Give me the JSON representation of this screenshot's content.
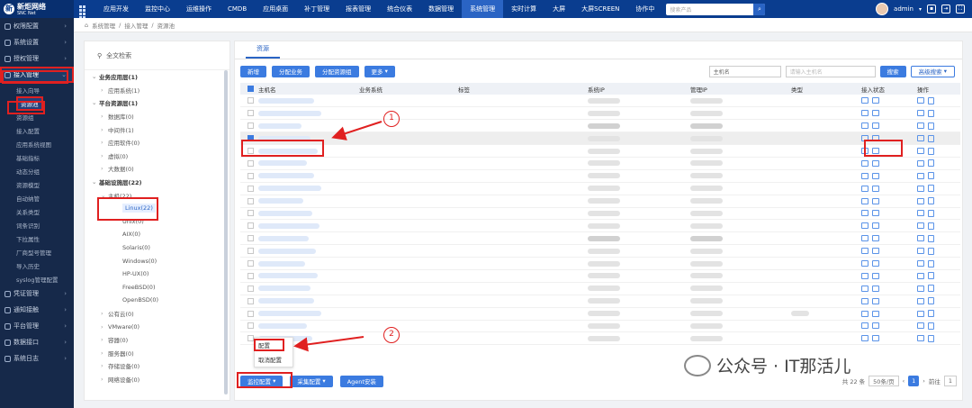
{
  "app": {
    "logo_title": "新炬网络",
    "logo_sub": "SNC Net"
  },
  "topnav": {
    "items": [
      "应用开发",
      "监控中心",
      "运维操作",
      "CMDB",
      "应用桌面",
      "补丁管理",
      "报表管理",
      "统合仪表",
      "数据管理",
      "系统管理",
      "实时计算",
      "大屏",
      "大屏SCREEN",
      "协作中"
    ],
    "active_index": 9,
    "search_placeholder": "搜索产品",
    "user": "admin"
  },
  "sidebar": {
    "items": [
      {
        "label": "权限配置"
      },
      {
        "label": "系统设置"
      },
      {
        "label": "授权管理"
      },
      {
        "label": "接入管理",
        "open": true
      }
    ],
    "sub_items": [
      "接入向导",
      "资源池",
      "资源组",
      "接入配置",
      "应用系统视图",
      "基础指标",
      "动态分组",
      "资源模型",
      "自动纳管",
      "关系类型",
      "词条识别",
      "下拉属性",
      "厂商型号管理",
      "导入历史",
      "syslog管理配置"
    ],
    "active_sub": 1,
    "bottom_items": [
      {
        "label": "凭证管理"
      },
      {
        "label": "通知接触"
      },
      {
        "label": "平台管理"
      },
      {
        "label": "数据接口"
      },
      {
        "label": "系统日志"
      }
    ]
  },
  "breadcrumb": [
    "系统管理",
    "接入管理",
    "资源池"
  ],
  "left_panel": {
    "search_label": "全文检索",
    "tree": [
      {
        "label": "业务应用层(1)",
        "level": 0
      },
      {
        "label": "应用系统(1)",
        "level": 1
      },
      {
        "label": "平台资源层(1)",
        "level": 0
      },
      {
        "label": "数据库(0)",
        "level": 1
      },
      {
        "label": "中间件(1)",
        "level": 1
      },
      {
        "label": "应用软件(0)",
        "level": 1
      },
      {
        "label": "虚拟(0)",
        "level": 1
      },
      {
        "label": "大数据(0)",
        "level": 1
      },
      {
        "label": "基础设施层(22)",
        "level": 0
      },
      {
        "label": "主机(22)",
        "level": 1,
        "expanded": true
      },
      {
        "label": "Linux(22)",
        "level": 2,
        "selected": true
      },
      {
        "label": "Unix(0)",
        "level": 2
      },
      {
        "label": "AIX(0)",
        "level": 2
      },
      {
        "label": "Solaris(0)",
        "level": 2
      },
      {
        "label": "Windows(0)",
        "level": 2
      },
      {
        "label": "HP-UX(0)",
        "level": 2
      },
      {
        "label": "FreeBSD(0)",
        "level": 2
      },
      {
        "label": "OpenBSD(0)",
        "level": 2
      },
      {
        "label": "公有云(0)",
        "level": 1
      },
      {
        "label": "VMware(0)",
        "level": 1
      },
      {
        "label": "容器(0)",
        "level": 1
      },
      {
        "label": "服务器(0)",
        "level": 1
      },
      {
        "label": "存储设备(0)",
        "level": 1
      },
      {
        "label": "网络设备(0)",
        "level": 1
      }
    ]
  },
  "main": {
    "tab": "资源",
    "toolbar": {
      "new": "新增",
      "assign_biz": "分配业务",
      "assign_group": "分配资源组",
      "more": "更多",
      "host_select": "主机名",
      "host_placeholder": "请输入主机名",
      "search": "搜索",
      "advanced": "高级搜索"
    },
    "columns": [
      "主机名",
      "业务系统",
      "标签",
      "系统IP",
      "管理IP",
      "类型",
      "接入状态",
      "操作"
    ],
    "row_count": 20,
    "selected_row": 3,
    "bottom": {
      "monitor_config": "监控配置",
      "collect_config": "采集配置",
      "agent_install": "Agent安装"
    },
    "popup_menu": [
      "配置",
      "取消配置"
    ],
    "pager": {
      "total": "共 22 条",
      "page_size": "50条/页",
      "current": "1",
      "goto": "前往",
      "goto_page": "1"
    }
  },
  "annotations": {
    "callout_1": "1",
    "callout_2": "2"
  },
  "watermark": "公众号 · IT那活儿",
  "colors": {
    "topbar": "#0a3d8f",
    "sidebar": "#16294a",
    "accent": "#3b7be0",
    "annotation": "#e02020"
  }
}
